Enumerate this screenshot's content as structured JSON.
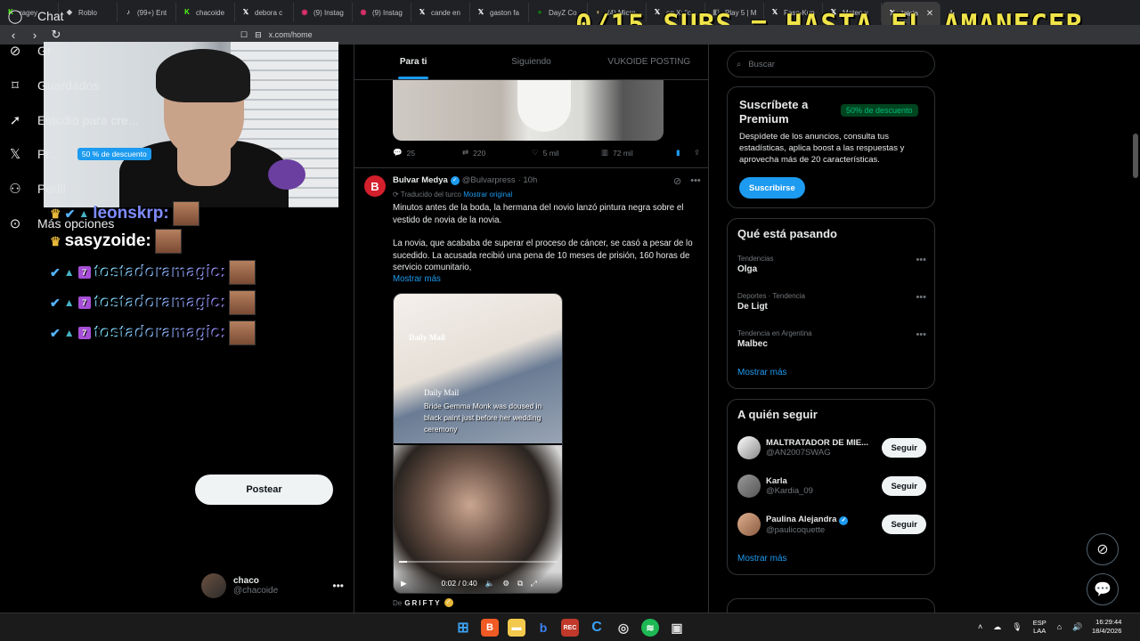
{
  "browser": {
    "tabs": [
      {
        "label": "ragey",
        "icon": "kick-icon",
        "color": "#53fc18"
      },
      {
        "label": "Roblo",
        "icon": "roblox-icon",
        "color": "#cccccc"
      },
      {
        "label": "(99+) Ent",
        "icon": "tiktok-icon",
        "color": "#ffffff"
      },
      {
        "label": "chacoide",
        "icon": "kick-icon",
        "color": "#53fc18"
      },
      {
        "label": "debora c",
        "icon": "x-icon",
        "color": "#ffffff"
      },
      {
        "label": "(9) Instag",
        "icon": "instagram-icon",
        "color": "#e1306c"
      },
      {
        "label": "(9) Instag",
        "icon": "instagram-icon",
        "color": "#e1306c"
      },
      {
        "label": "cande en",
        "icon": "x-icon",
        "color": "#ffffff"
      },
      {
        "label": "gaston fa",
        "icon": "x-icon",
        "color": "#ffffff"
      },
      {
        "label": "DayZ Co",
        "icon": "xbox-icon",
        "color": "#107c10"
      },
      {
        "label": "(4) Micro",
        "icon": "edge-icon",
        "color": "#d0b070"
      },
      {
        "label": "en X: \"c",
        "icon": "x-icon",
        "color": "#ffffff"
      },
      {
        "label": "Play 5 | M",
        "icon": "gamepad-icon",
        "color": "#888888"
      },
      {
        "label": "Faso-Kun",
        "icon": "x-icon",
        "color": "#ffffff"
      },
      {
        "label": "Mateo y",
        "icon": "x-icon",
        "color": "#ffffff"
      },
      {
        "label": "Inicio",
        "icon": "x-icon",
        "color": "#ffffff",
        "active": true
      }
    ],
    "url": "x.com/home",
    "overlay_banner": "0/15 SUBS = HASTA EL AMANECER"
  },
  "stream_chat": [
    {
      "user": "leonskrp:",
      "badges": [
        "crown",
        "check",
        "bag"
      ]
    },
    {
      "user": "sasyzoide:",
      "badges": [
        "crown"
      ]
    },
    {
      "user": "tostadoramagic:",
      "badges": [
        "check",
        "bag",
        "7tv"
      ]
    },
    {
      "user": "tostadoramagic:",
      "badges": [
        "check",
        "bag",
        "7tv"
      ]
    },
    {
      "user": "tostadoramagic:",
      "badges": [
        "check",
        "bag",
        "7tv"
      ]
    }
  ],
  "left_nav": {
    "items": [
      {
        "label": "Chat",
        "icon": "chat-icon"
      },
      {
        "label": "Gr",
        "icon": "grok-icon"
      },
      {
        "label": "Guardados",
        "icon": "bookmark-icon"
      },
      {
        "label": "Estudio para cre...",
        "icon": "rocket-icon"
      },
      {
        "label": "Pr...",
        "icon": "x-logo-icon",
        "chip": "50 % de descuento"
      },
      {
        "label": "Perfil",
        "icon": "person-icon"
      },
      {
        "label": "Más opciones",
        "icon": "more-circle-icon"
      }
    ],
    "post_button": "Postear",
    "account": {
      "name": "chaco",
      "handle": "@chacoide"
    }
  },
  "feed": {
    "tabs": [
      {
        "label": "Para ti",
        "active": true
      },
      {
        "label": "Siguiendo",
        "active": false
      },
      {
        "label": "VUKOIDE POSTING",
        "active": false
      }
    ],
    "prev_actions": {
      "replies": "25",
      "reposts": "220",
      "likes": "5 mil",
      "views": "72 mil"
    },
    "tweet": {
      "name": "Bulvar Medya",
      "handle": "@Bulvarpress",
      "time": "· 10h",
      "translated_note": "Traducido del turco",
      "translated_link": "Mostrar original",
      "paragraph1": "Minutos antes de la boda, la hermana del novio lanzó pintura negra sobre el vestido de novia de la novia.",
      "paragraph2": "La novia, que acababa de superar el proceso de cáncer, se casó a pesar de lo sucedido. La acusada recibió una pena de 10 meses de prisión, 160 horas de servicio comunitario,",
      "show_more": "Mostrar más",
      "media_logo": "Daily Mail",
      "media_caption": "Bride Gemma Monk was doused in black paint just before her wedding ceremony",
      "video_time": "0:02 / 0:40",
      "video_progress": 0.05,
      "from_label": "De",
      "from_brand": "GRIFTY"
    }
  },
  "right": {
    "search_placeholder": "Buscar",
    "premium": {
      "title": "Suscríbete a Premium",
      "chip": "50% de descuento",
      "desc": "Despídete de los anuncios, consulta tus estadísticas, aplica boost a las respuestas y aprovecha más de 20 características.",
      "button": "Suscribirse"
    },
    "trending": {
      "title": "Qué está pasando",
      "items": [
        {
          "meta": "Tendencias",
          "name": "Olga"
        },
        {
          "meta": "Deportes · Tendencia",
          "name": "De Ligt"
        },
        {
          "meta": "Tendencia en Argentina",
          "name": "Malbec"
        }
      ],
      "more": "Mostrar más"
    },
    "who_to_follow": {
      "title": "A quién seguir",
      "items": [
        {
          "name": "MALTRATADOR DE MIE...",
          "handle": "@AN2007SWAG",
          "button": "Seguir",
          "verified": false
        },
        {
          "name": "Karla",
          "handle": "@Kardia_09",
          "button": "Seguir",
          "verified": false
        },
        {
          "name": "Paulina Alejandra",
          "handle": "@paulicoquette",
          "button": "Seguir",
          "verified": true
        }
      ],
      "more": "Mostrar más"
    }
  },
  "taskbar": {
    "lang_top": "ESP",
    "lang_bottom": "LAA",
    "time": "16:29:44",
    "date": "18/4/2026"
  }
}
